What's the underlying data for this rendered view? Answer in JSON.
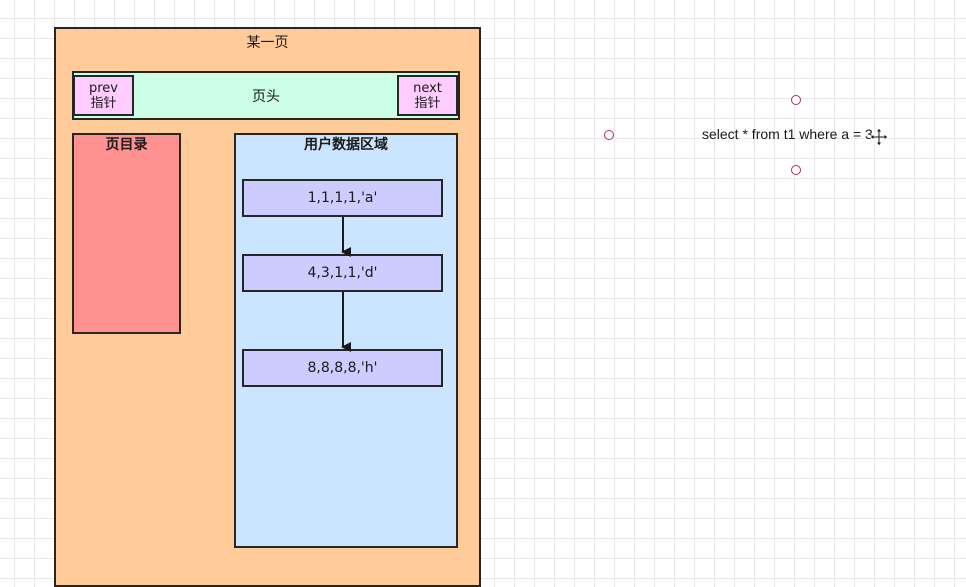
{
  "page": {
    "title": "某一页",
    "header": {
      "label": "页头",
      "prev": {
        "line1": "prev",
        "line2": "指针"
      },
      "next": {
        "line1": "next",
        "line2": "指针"
      }
    },
    "directory": {
      "label": "页目录"
    },
    "user_data": {
      "label": "用户数据区域",
      "records": [
        "1,1,1,1,'a'",
        "4,3,1,1,'d'",
        "8,8,8,8,'h'"
      ]
    }
  },
  "canvas": {
    "query_text": "select * from t1 where a = 3",
    "cursor_icon": "move-cursor-icon"
  },
  "colors": {
    "page": "#ffcc99",
    "header": "#ccffe6",
    "pointer": "#ffccff",
    "directory": "#ff9191",
    "user_data": "#cce5ff",
    "record": "#ccccff"
  }
}
